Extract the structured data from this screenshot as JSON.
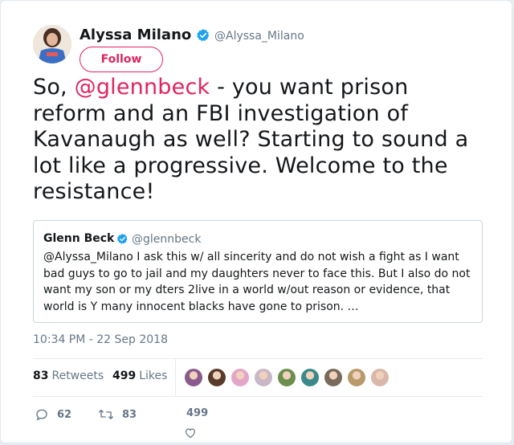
{
  "author": {
    "name": "Alyssa Milano",
    "handle": "@Alyssa_Milano",
    "follow_label": "Follow"
  },
  "tweet": {
    "text_prefix": "So, ",
    "mention": "@glennbeck",
    "text_suffix": " - you want prison reform and an FBI investigation of Kavanaugh as well? Starting to sound a lot like a progressive. Welcome to the resistance!"
  },
  "quoted": {
    "name": "Glenn Beck",
    "handle": "@glennbeck",
    "text": "@Alyssa_Milano I ask this w/ all sincerity and do not wish a fight as I want bad guys to go to jail and my daughters never to face this. But I also do not want my son or my dters 2live in a world w/out reason or evidence, that world is Y many innocent blacks have gone to prison. …"
  },
  "timestamp": "10:34 PM - 22 Sep 2018",
  "stats": {
    "retweets_count": "83",
    "retweets_label": "Retweets",
    "likes_count": "499",
    "likes_label": "Likes"
  },
  "actions": {
    "replies": "62",
    "retweets": "83",
    "likes": "499"
  },
  "colors": {
    "accent": "#e0245e",
    "verified": "#1da1f2",
    "muted": "#657786"
  },
  "liker_avatars": [
    "#8a5a8c",
    "#5a3a2a",
    "#e4a6c8",
    "#c9b8c8",
    "#6b8e4e",
    "#3a8a8a",
    "#7a6a5a",
    "#b89a6a",
    "#d8b8a8"
  ]
}
